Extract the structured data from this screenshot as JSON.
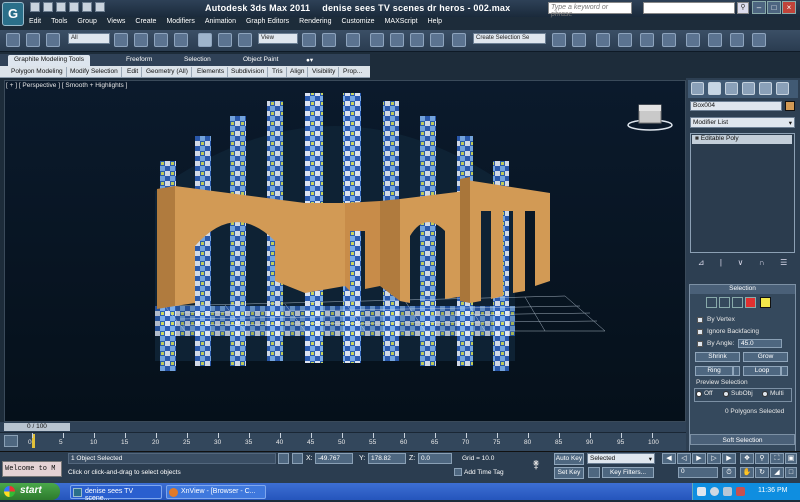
{
  "title_bar": {
    "app": "Autodesk 3ds Max  2011",
    "file": "denise sees TV scenes dr heros - 002.max",
    "search_placeholder": "Type a keyword or phrase"
  },
  "menu": [
    "Edit",
    "Tools",
    "Group",
    "Views",
    "Create",
    "Modifiers",
    "Animation",
    "Graph Editors",
    "Rendering",
    "Customize",
    "MAXScript",
    "Help"
  ],
  "toolbar": {
    "filter": "All",
    "view": "View",
    "selection_set": "Create Selection Se"
  },
  "ribbon": {
    "tabs": [
      "Graphite Modeling Tools",
      "Freeform",
      "Selection",
      "Object Paint"
    ],
    "panels": [
      "Polygon Modeling",
      "Modify Selection",
      "Edit",
      "Geometry (All)",
      "Elements",
      "Subdivision",
      "Tris",
      "Align",
      "Visibility",
      "Prop..."
    ]
  },
  "viewport": {
    "label": "[ + ] [ Perspective ] [ Smooth + Highlights ]"
  },
  "command_panel": {
    "object_name": "Box004",
    "object_color": "#d29a55",
    "modifier_list": "Modifier List",
    "stack": [
      "Editable Poly"
    ],
    "selection": {
      "header": "Selection",
      "by_vertex": "By Vertex",
      "ignore_backfacing": "Ignore Backfacing",
      "by_angle": "By Angle:",
      "angle_value": "45.0",
      "shrink": "Shrink",
      "grow": "Grow",
      "ring": "Ring",
      "loop": "Loop",
      "preview_title": "Preview Selection",
      "preview_off": "Off",
      "preview_subobj": "SubObj",
      "preview_multi": "Multi",
      "count": "0 Polygons Selected"
    },
    "soft_selection": "Soft Selection"
  },
  "timeline": {
    "slider": "0 / 100",
    "ticks": [
      "0",
      "5",
      "10",
      "15",
      "20",
      "25",
      "30",
      "35",
      "40",
      "45",
      "50",
      "55",
      "60",
      "65",
      "70",
      "75",
      "80",
      "85",
      "90",
      "95",
      "100"
    ]
  },
  "status": {
    "welcome": "Welcome to M",
    "objects_selected": "1 Object Selected",
    "prompt": "Click or click-and-drag to select objects",
    "x_label": "X:",
    "x": "-49.767",
    "y_label": "Y:",
    "y": "178.82",
    "z_label": "Z:",
    "z": "0.0",
    "grid": "Grid = 10.0",
    "add_time_tag": "Add Time Tag",
    "auto_key": "Auto Key",
    "set_key": "Set Key",
    "selected": "Selected",
    "key_filters": "Key Filters...",
    "frame": "0"
  },
  "taskbar": {
    "start": "start",
    "tasks": [
      "denise sees TV scene...",
      "XnView - [Browser - C..."
    ],
    "clock": "11:36 PM"
  }
}
